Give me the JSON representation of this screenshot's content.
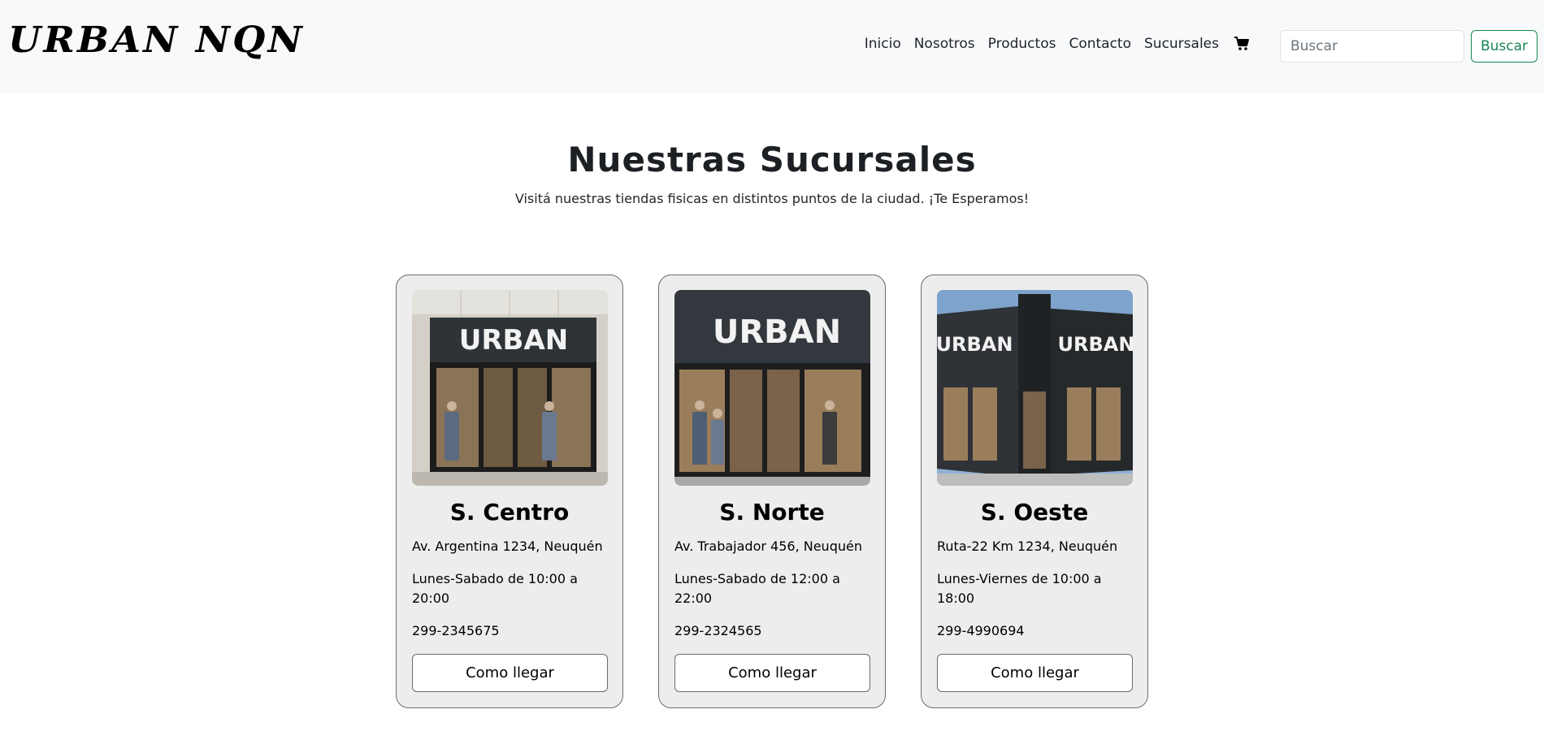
{
  "brand": {
    "logo_text": "URBAN NQN"
  },
  "nav": {
    "links": [
      "Inicio",
      "Nosotros",
      "Productos",
      "Contacto",
      "Sucursales"
    ],
    "cart_icon": "cart-icon"
  },
  "search": {
    "placeholder": "Buscar",
    "button_label": "Buscar"
  },
  "header": {
    "title": "Nuestras Sucursales",
    "subtitle": "Visitá nuestras tiendas fisicas en distintos puntos de la ciudad. ¡Te Esperamos!"
  },
  "stores": [
    {
      "image_sign": "URBAN",
      "name": "S. Centro",
      "address": "Av. Argentina 1234, Neuquén",
      "hours": "Lunes-Sabado de 10:00 a 20:00",
      "phone": "299-2345675",
      "button_label": "Como llegar"
    },
    {
      "image_sign": "URBAN",
      "name": "S. Norte",
      "address": "Av. Trabajador 456, Neuquén",
      "hours": "Lunes-Sabado de 12:00 a 22:00",
      "phone": "299-2324565",
      "button_label": "Como llegar"
    },
    {
      "image_sign": "URBAN",
      "name": "S. Oeste",
      "address": "Ruta-22 Km 1234, Neuquén",
      "hours": "Lunes-Viernes de 10:00 a 18:00",
      "phone": "299-4990694",
      "button_label": "Como llegar"
    }
  ],
  "colors": {
    "navbar_bg": "#f8f9fa",
    "search_button_accent": "#198754",
    "card_bg": "#ededed",
    "card_border": "#6c6c6c"
  }
}
